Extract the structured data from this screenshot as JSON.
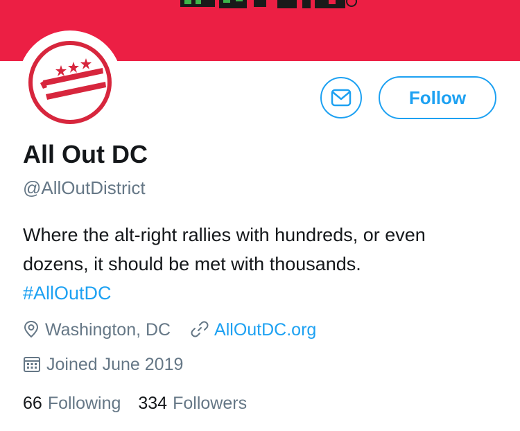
{
  "banner": {
    "color": "#ec1f44",
    "logo_colors": [
      "#1a1a1a",
      "#3db54a",
      "#1a1a1a"
    ]
  },
  "avatar": {
    "icon": "dc-flag-logo",
    "color": "#d7263d"
  },
  "actions": {
    "message_icon": "envelope-icon",
    "follow_label": "Follow"
  },
  "profile": {
    "display_name": "All Out DC",
    "handle": "@AllOutDistrict",
    "bio_line_1": "Where the alt-right rallies with hundreds, or even",
    "bio_line_2": "dozens, it should be met with thousands.",
    "hashtag": "#AllOutDC",
    "location": "Washington, DC",
    "website": "AllOutDC.org",
    "joined": "Joined June 2019"
  },
  "stats": {
    "following_count": "66",
    "following_label": "Following",
    "followers_count": "334",
    "followers_label": "Followers"
  },
  "colors": {
    "accent": "#1da1f2",
    "text": "#14171a",
    "secondary": "#657786"
  }
}
